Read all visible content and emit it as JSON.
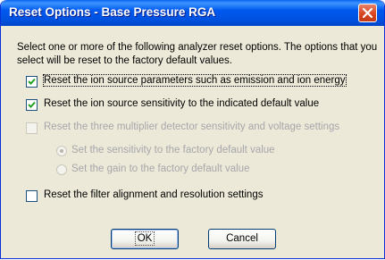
{
  "window": {
    "title": "Reset Options - Base Pressure RGA"
  },
  "intro": "Select one or more of the following analyzer reset options.  The options that you select will be reset to the factory default values.",
  "options": [
    {
      "label": "Reset the ion source parameters such as emission and ion energy",
      "checked": true,
      "enabled": true
    },
    {
      "label": "Reset the ion source sensitivity to the indicated default value",
      "checked": true,
      "enabled": true
    },
    {
      "label": "Reset the three multiplier detector sensitivity and voltage settings",
      "checked": false,
      "enabled": false
    }
  ],
  "radios": [
    {
      "label": "Set the sensitivity to the factory default value",
      "selected": true,
      "enabled": false
    },
    {
      "label": "Set the gain to the factory default value",
      "selected": false,
      "enabled": false
    }
  ],
  "filter_option": {
    "label": "Reset the filter alignment and resolution settings",
    "checked": false,
    "enabled": true
  },
  "buttons": {
    "ok": "OK",
    "cancel": "Cancel"
  }
}
